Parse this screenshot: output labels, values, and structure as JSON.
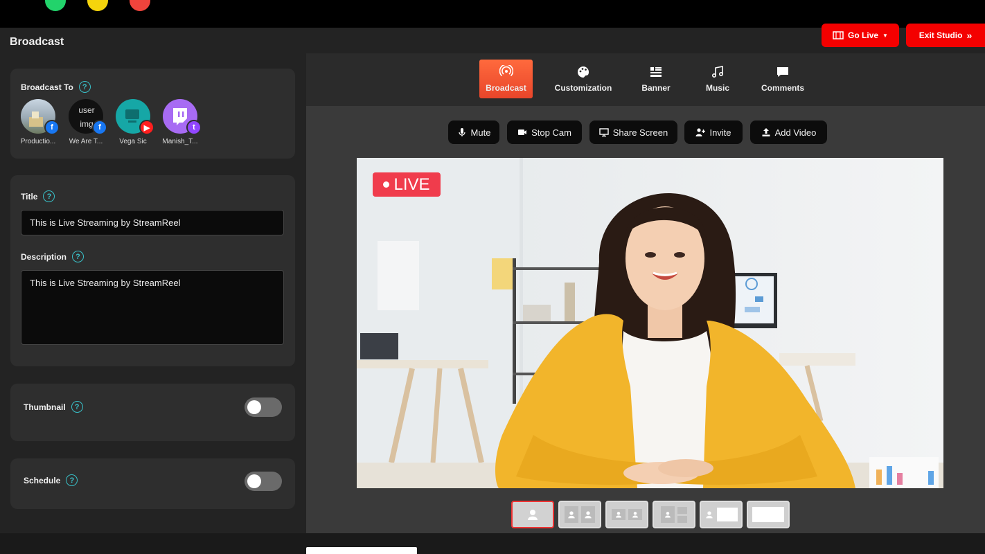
{
  "window": {
    "controls": [
      "close",
      "minimize",
      "maximize"
    ]
  },
  "header": {
    "title": "Broadcast",
    "go_live_label": "Go Live",
    "exit_label": "Exit Studio"
  },
  "broadcast_to": {
    "label": "Broadcast To",
    "destinations": [
      {
        "name": "Productio...",
        "platform": "facebook",
        "image_alt": ""
      },
      {
        "name": "We Are T...",
        "platform": "facebook",
        "image_alt": "user img"
      },
      {
        "name": "Vega Sic",
        "platform": "youtube",
        "image_alt": ""
      },
      {
        "name": "Manish_T...",
        "platform": "twitch",
        "image_alt": ""
      }
    ]
  },
  "form": {
    "title_label": "Title",
    "title_value": "This is Live Streaming by StreamReel",
    "description_label": "Description",
    "description_value": "This is Live Streaming by StreamReel"
  },
  "thumbnail": {
    "label": "Thumbnail",
    "enabled": false
  },
  "schedule": {
    "label": "Schedule",
    "enabled": false
  },
  "tabs": [
    {
      "label": "Broadcast",
      "icon": "broadcast-icon",
      "active": true
    },
    {
      "label": "Customization",
      "icon": "palette-icon",
      "active": false
    },
    {
      "label": "Banner",
      "icon": "banner-icon",
      "active": false
    },
    {
      "label": "Music",
      "icon": "music-icon",
      "active": false
    },
    {
      "label": "Comments",
      "icon": "comment-icon",
      "active": false
    }
  ],
  "controls": [
    {
      "label": "Mute",
      "icon": "microphone-icon"
    },
    {
      "label": "Stop Cam",
      "icon": "camera-icon"
    },
    {
      "label": "Share Screen",
      "icon": "monitor-icon"
    },
    {
      "label": "Invite",
      "icon": "add-user-icon"
    },
    {
      "label": "Add Video",
      "icon": "upload-icon"
    }
  ],
  "preview": {
    "live_label": "LIVE"
  },
  "layouts": [
    {
      "name": "single",
      "active": true
    },
    {
      "name": "side-by-side",
      "active": false
    },
    {
      "name": "split-equal",
      "active": false
    },
    {
      "name": "grid",
      "active": false
    },
    {
      "name": "person-screen",
      "active": false
    },
    {
      "name": "screen-only",
      "active": false
    }
  ],
  "colors": {
    "accent": "#f40000",
    "tab_active": "#e8452a",
    "help": "#39c0c8",
    "live": "#f03c4c"
  }
}
